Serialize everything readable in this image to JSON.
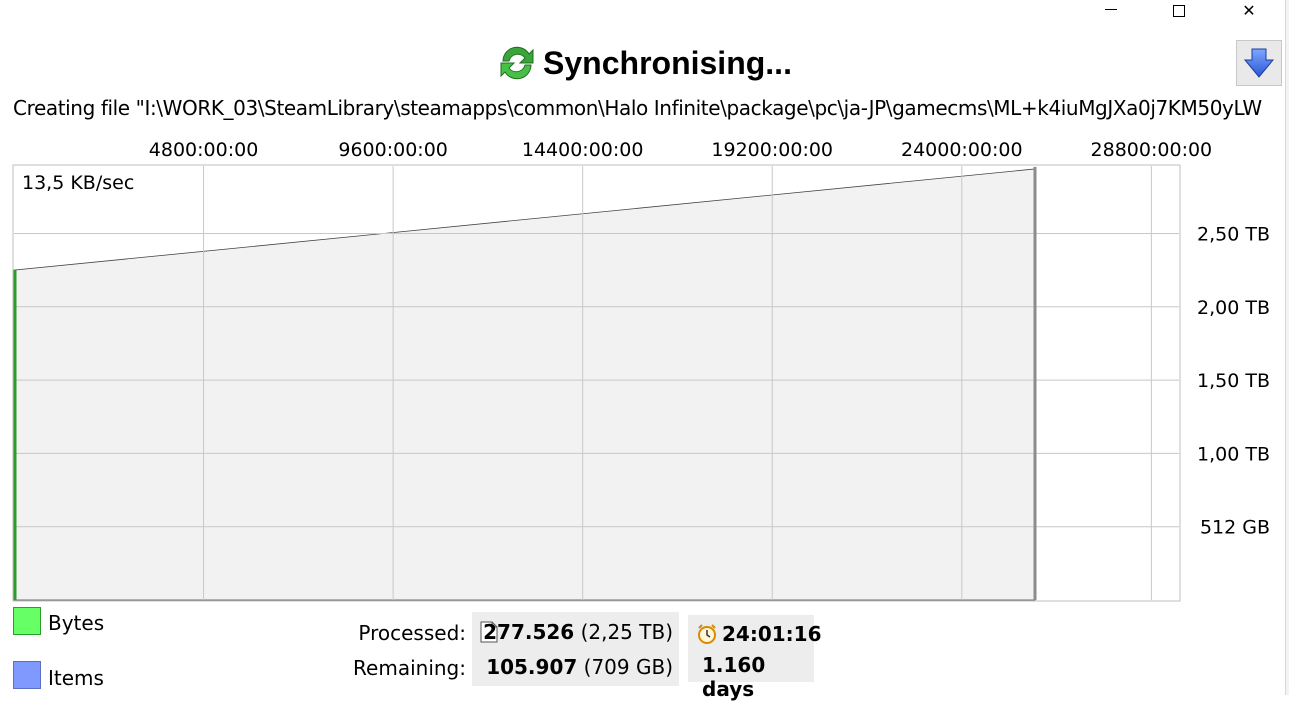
{
  "window": {
    "minimize_glyph": "minimize-icon",
    "maximize_glyph": "maximize-icon",
    "close_glyph": "✕"
  },
  "header": {
    "title": "Synchronising...",
    "icon": "sync-arrows-icon",
    "side_button_icon": "arrow-down-icon",
    "status_text": "Creating file \"I:\\WORK_03\\SteamLibrary\\steamapps\\common\\Halo Infinite\\package\\pc\\ja-JP\\gamecms\\ML+k4iuMgJXa0j7KM50yLW"
  },
  "colors": {
    "bytes": "#66ff66",
    "items": "#7f99ff",
    "area_fill": "#f2f2f2",
    "grid": "#c8c8c8",
    "progress_line": "#2a9d2a"
  },
  "chart_data": {
    "type": "area",
    "speed_label": "13,5 KB/sec",
    "x_ticks": [
      "4800:00:00",
      "9600:00:00",
      "14400:00:00",
      "19200:00:00",
      "24000:00:00",
      "28800:00:00"
    ],
    "x_tick_values_hours": [
      4800,
      9600,
      14400,
      19200,
      24000,
      28800
    ],
    "xlim_hours": [
      0,
      29500
    ],
    "y_ticks": [
      "2,50 TB",
      "2,00 TB",
      "1,50 TB",
      "1,00 TB",
      "512 GB"
    ],
    "y_tick_values_tb": [
      2.5,
      2.0,
      1.5,
      1.0,
      0.5
    ],
    "ylim_tb": [
      0,
      2.96
    ],
    "series": [
      {
        "name": "Bytes",
        "points": [
          {
            "x": 0,
            "y": 2.25
          },
          {
            "x": 29500,
            "y": 2.94
          }
        ]
      }
    ],
    "current_progress_x_hours": 0,
    "end_x_hours": 29500,
    "legend": [
      {
        "label": "Bytes",
        "color": "#66ff66"
      },
      {
        "label": "Items",
        "color": "#7f99ff"
      }
    ],
    "legend_placement": "bottom-left",
    "grid": true
  },
  "stats": {
    "processed_label": "Processed:",
    "remaining_label": "Remaining:",
    "processed_count": "277.526",
    "processed_size": "(2,25 TB)",
    "remaining_count": "105.907",
    "remaining_size": "(709 GB)",
    "file_icon": "file-icon",
    "clock_icon": "alarm-clock-icon",
    "elapsed_time": "24:01:16",
    "remaining_time": "1.160 days"
  }
}
